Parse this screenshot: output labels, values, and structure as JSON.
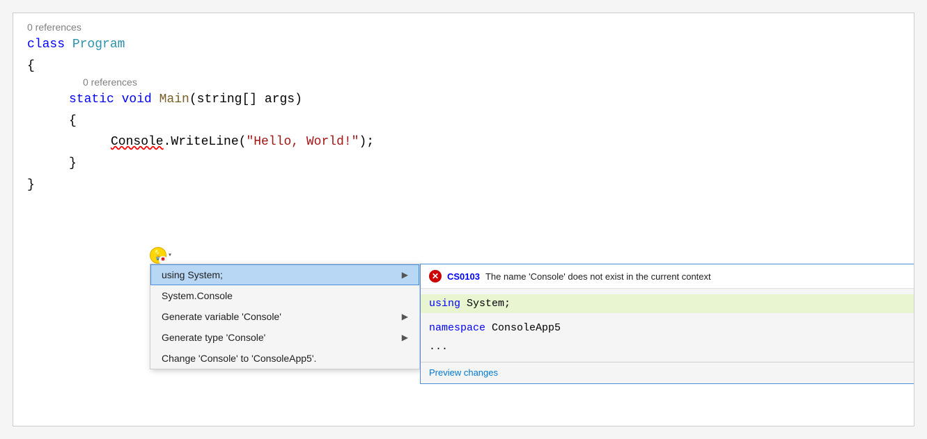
{
  "editor": {
    "background": "#ffffff",
    "lines": {
      "ref_top": "0 references",
      "class_keyword": "class",
      "class_name": "Program",
      "brace_open": "{",
      "ref_method": "0 references",
      "static_keyword": "static",
      "void_keyword": "void",
      "main_keyword": "Main",
      "params": "(string[] args)",
      "brace_open2": "{",
      "console_line": "Console.WriteLine(",
      "hello_string": "\"Hello, World!\"",
      "semi": ");",
      "brace_close": "}",
      "brace_close2": "}"
    }
  },
  "lightbulb": {
    "icon": "💡",
    "dropdown": "▾"
  },
  "context_menu": {
    "items": [
      {
        "id": "using-system",
        "label": "using System;",
        "has_arrow": true,
        "selected": true
      },
      {
        "id": "system-console",
        "label": "System.Console",
        "has_arrow": false,
        "selected": false
      },
      {
        "id": "generate-variable",
        "label": "Generate variable 'Console'",
        "has_arrow": true,
        "selected": false
      },
      {
        "id": "generate-type",
        "label": "Generate type 'Console'",
        "has_arrow": true,
        "selected": false
      },
      {
        "id": "change-console",
        "label": "Change 'Console' to 'ConsoleApp5'.",
        "has_arrow": false,
        "selected": false
      }
    ]
  },
  "preview_panel": {
    "error": {
      "code": "CS0103",
      "message": "The name 'Console' does not exist in the current context"
    },
    "code_lines": [
      {
        "text": "using System;",
        "highlighted": true,
        "kw": "using",
        "rest": " System;"
      },
      {
        "text": "",
        "highlighted": false
      },
      {
        "text": "namespace ConsoleApp5",
        "highlighted": false,
        "kw": "namespace",
        "rest": " ConsoleApp5"
      },
      {
        "text": "...",
        "highlighted": false
      }
    ],
    "footer_link": "Preview changes"
  }
}
